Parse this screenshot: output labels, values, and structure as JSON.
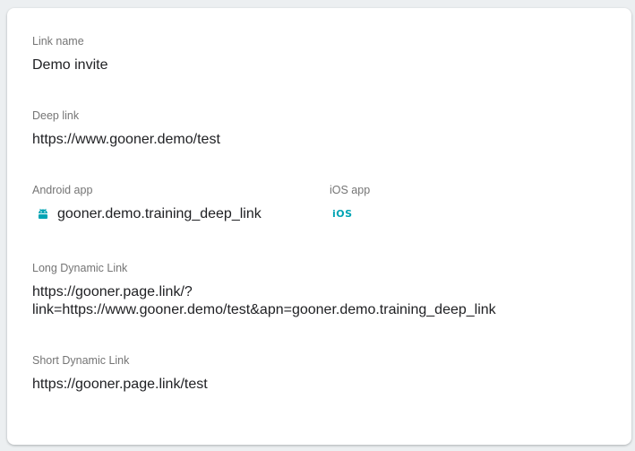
{
  "link_name": {
    "label": "Link name",
    "value": "Demo invite"
  },
  "deep_link": {
    "label": "Deep link",
    "value": "https://www.gooner.demo/test"
  },
  "android_app": {
    "label": "Android app",
    "value": "gooner.demo.training_deep_link",
    "icon": "android-icon"
  },
  "ios_app": {
    "label": "iOS app",
    "icon_text": "iOS",
    "icon": "ios-icon"
  },
  "long_dynamic_link": {
    "label": "Long Dynamic Link",
    "line1": "https://gooner.page.link/?",
    "line2": "link=https://www.gooner.demo/test&apn=gooner.demo.training_deep_link"
  },
  "short_dynamic_link": {
    "label": "Short Dynamic Link",
    "value": "https://gooner.page.link/test"
  },
  "colors": {
    "accent": "#00a4b4",
    "label": "#757575",
    "text": "#202124",
    "background": "#eceff1"
  }
}
